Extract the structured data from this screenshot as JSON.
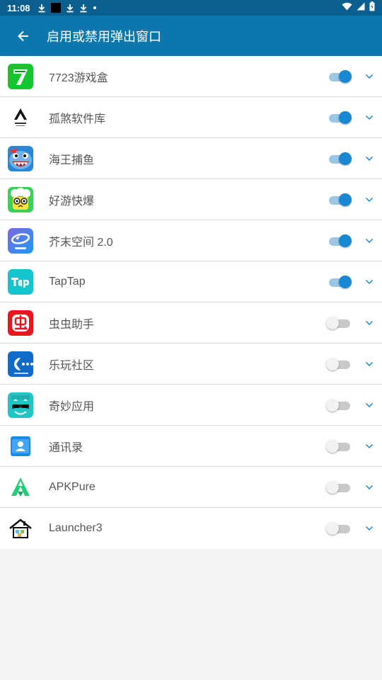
{
  "status_bar": {
    "time": "11:08",
    "icons": [
      "download-icon",
      "square-icon",
      "download-icon",
      "download-icon",
      "dot-icon"
    ],
    "right_icons": [
      "wifi-icon",
      "cell-signal-icon",
      "battery-icon"
    ]
  },
  "app_bar": {
    "back_icon": "arrow-back-icon",
    "title": "启用或禁用弹出窗口",
    "color": "#0b77ad"
  },
  "colors": {
    "status_bar": "#0a5f8f",
    "switch_on": "#1a87d2",
    "switch_on_track": "#9bc7e5",
    "switch_off_track": "#c9c9c9",
    "chevron": "#1a87d2"
  },
  "apps": [
    {
      "name": "7723游戏盒",
      "enabled": true,
      "icon": "7723-icon"
    },
    {
      "name": "孤煞软件库",
      "enabled": true,
      "icon": "gusha-icon"
    },
    {
      "name": "海王捕鱼",
      "enabled": true,
      "icon": "shark-fishing-icon"
    },
    {
      "name": "好游快爆",
      "enabled": true,
      "icon": "haoyou-icon"
    },
    {
      "name": "芥末空间 2.0",
      "enabled": true,
      "icon": "jiemo-icon"
    },
    {
      "name": "TapTap",
      "enabled": true,
      "icon": "taptap-icon"
    },
    {
      "name": "虫虫助手",
      "enabled": false,
      "icon": "chongchong-icon"
    },
    {
      "name": "乐玩社区",
      "enabled": false,
      "icon": "lewan-icon"
    },
    {
      "name": "奇妙应用",
      "enabled": false,
      "icon": "magic-icon"
    },
    {
      "name": "通讯录",
      "enabled": false,
      "icon": "contacts-icon"
    },
    {
      "name": "APKPure",
      "enabled": false,
      "icon": "apkpure-icon"
    },
    {
      "name": "Launcher3",
      "enabled": false,
      "icon": "launcher-icon"
    }
  ]
}
